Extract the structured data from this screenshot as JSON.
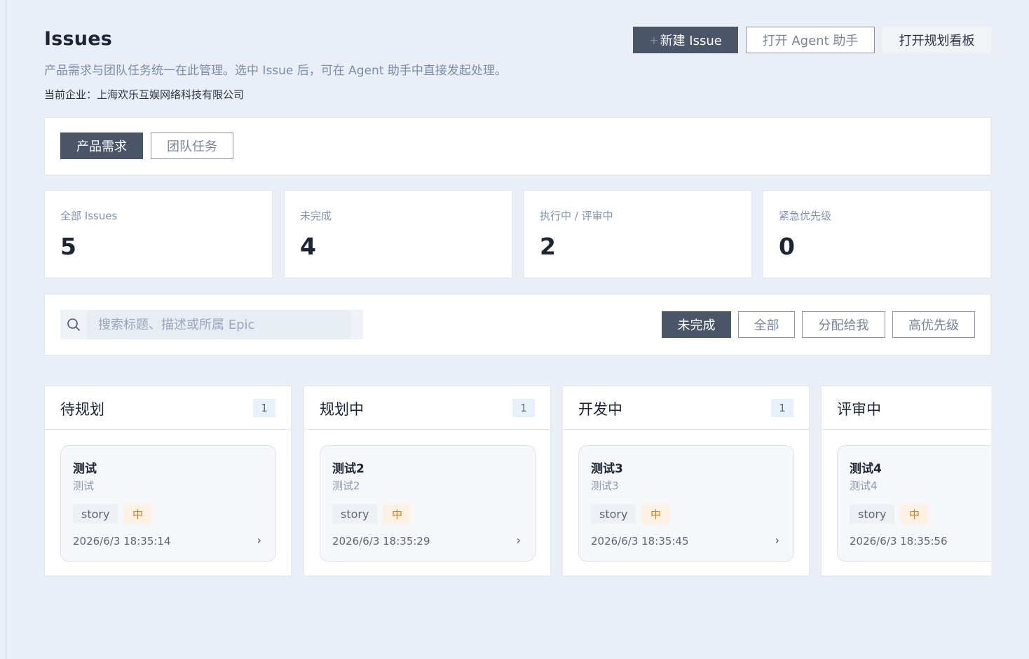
{
  "header": {
    "title": "Issues",
    "subtitle": "产品需求与团队任务统一在此管理。选中 Issue 后，可在 Agent 助手中直接发起处理。",
    "company": "当前企业：上海欢乐互娱网络科技有限公司",
    "new_issue_plus": "+",
    "new_issue_label": "新建 Issue",
    "open_agent_label": "打开 Agent 助手",
    "open_board_label": "打开规划看板"
  },
  "tabs": [
    {
      "label": "产品需求",
      "active": true
    },
    {
      "label": "团队任务",
      "active": false
    }
  ],
  "stats": [
    {
      "label": "全部 Issues",
      "value": "5"
    },
    {
      "label": "未完成",
      "value": "4"
    },
    {
      "label": "执行中 / 评审中",
      "value": "2"
    },
    {
      "label": "紧急优先级",
      "value": "0"
    }
  ],
  "search": {
    "placeholder": "搜索标题、描述或所属 Epic",
    "value": ""
  },
  "filters": [
    {
      "label": "未完成",
      "active": true
    },
    {
      "label": "全部",
      "active": false
    },
    {
      "label": "分配给我",
      "active": false
    },
    {
      "label": "高优先级",
      "active": false
    }
  ],
  "columns": [
    {
      "title": "待规划",
      "count": "1",
      "card": {
        "title": "测试",
        "desc": "测试",
        "type": "story",
        "priority": "中",
        "time": "2026/6/3 18:35:14",
        "chevron": "›"
      }
    },
    {
      "title": "规划中",
      "count": "1",
      "card": {
        "title": "测试2",
        "desc": "测试2",
        "type": "story",
        "priority": "中",
        "time": "2026/6/3 18:35:29",
        "chevron": "›"
      }
    },
    {
      "title": "开发中",
      "count": "1",
      "card": {
        "title": "测试3",
        "desc": "测试3",
        "type": "story",
        "priority": "中",
        "time": "2026/6/3 18:35:45",
        "chevron": "›"
      }
    },
    {
      "title": "评审中",
      "count": "",
      "card": {
        "title": "测试4",
        "desc": "测试4",
        "type": "story",
        "priority": "中",
        "time": "2026/6/3 18:35:56",
        "chevron": ""
      }
    }
  ],
  "colors": {
    "accent_dark": "#4a5568",
    "page_bg": "#eaeef6",
    "priority_medium": "#e07b1a",
    "muted_text": "#7b8cad"
  }
}
